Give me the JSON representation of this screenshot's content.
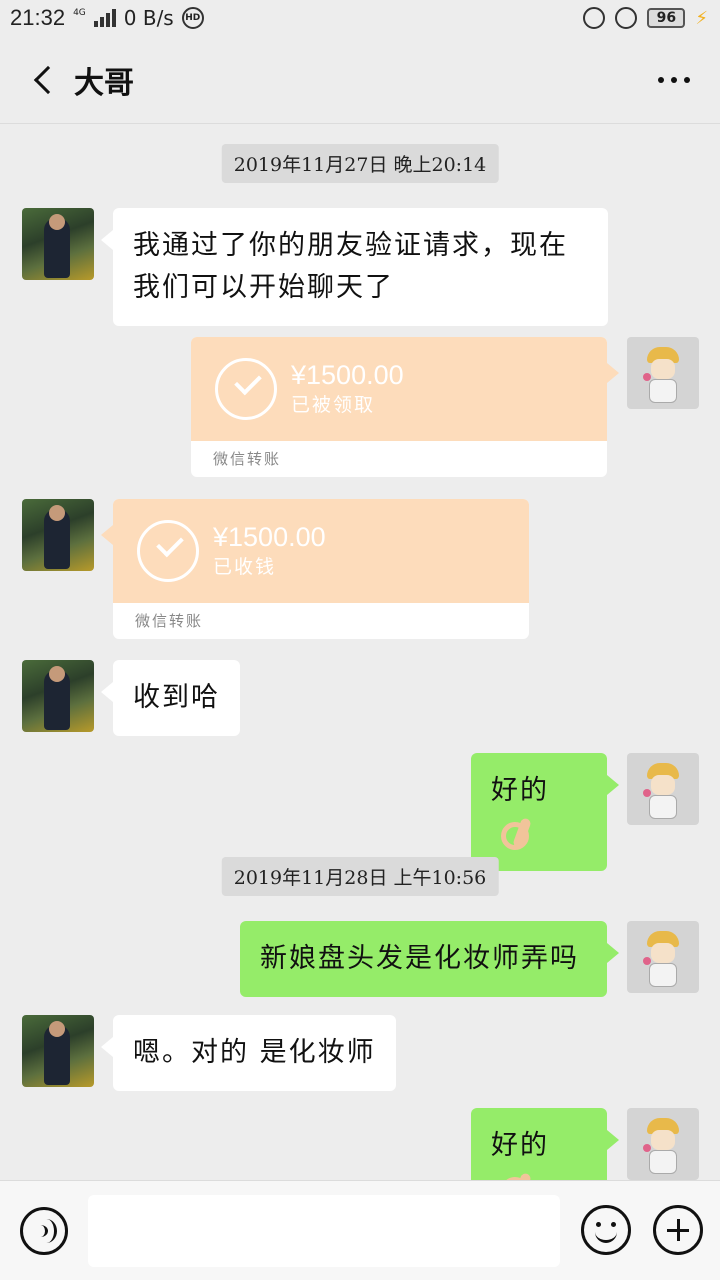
{
  "status_bar": {
    "time": "21:32",
    "network": "4G",
    "speed": "0 B/s",
    "hd": "HD",
    "battery": "96"
  },
  "header": {
    "title": "大哥"
  },
  "messages": {
    "ts1": "2019年11月27日 晚上20:14",
    "m1": "我通过了你的朋友验证请求，现在我们可以开始聊天了",
    "t1_amount": "¥1500.00",
    "t1_status": "已被领取",
    "t1_footer": "微信转账",
    "t2_amount": "¥1500.00",
    "t2_status": "已收钱",
    "t2_footer": "微信转账",
    "m2": "收到哈",
    "m3": "好的",
    "ts2": "2019年11月28日 上午10:56",
    "m4": "新娘盘头发是化妆师弄吗",
    "m5": "嗯。对的 是化妆师",
    "m6": "好的"
  },
  "input_bar": {
    "placeholder": ""
  },
  "colors": {
    "background": "#ededed",
    "my_bubble": "#95ec69",
    "their_bubble": "#ffffff",
    "transfer": "#fddcbb"
  }
}
